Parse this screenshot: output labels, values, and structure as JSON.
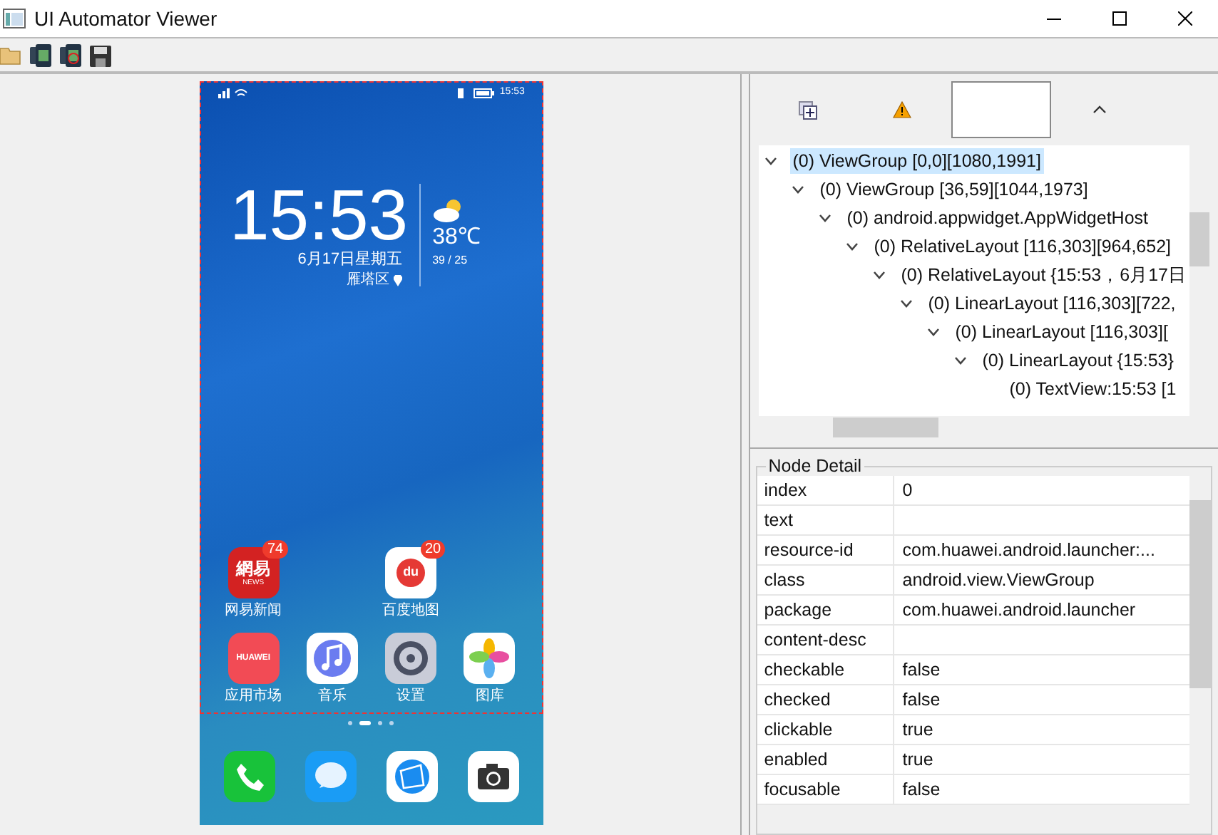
{
  "window": {
    "title": "UI Automator Viewer"
  },
  "phone": {
    "status_time": "15:53",
    "clock": "15:53",
    "date": "6月17日星期五",
    "location": "雁塔区",
    "temperature": "38℃",
    "temp_range": "39 / 25",
    "apps": [
      {
        "kind": "news",
        "label": "网易新闻",
        "badge": "74",
        "icon_text": "網易",
        "icon_subtext": "NEWS"
      },
      {
        "kind": "empty"
      },
      {
        "kind": "map",
        "label": "百度地图",
        "badge": "20",
        "icon_text": "du"
      },
      {
        "kind": "empty"
      },
      {
        "kind": "store",
        "label": "应用市场",
        "icon_text": "HUAWEI"
      },
      {
        "kind": "music",
        "label": "音乐"
      },
      {
        "kind": "settings",
        "label": "设置"
      },
      {
        "kind": "gallery",
        "label": "图库"
      }
    ],
    "pages": [
      {
        "selected": false
      },
      {
        "selected": true
      },
      {
        "selected": false
      },
      {
        "selected": false
      }
    ],
    "dock": [
      {
        "kind": "phone"
      },
      {
        "kind": "messages"
      },
      {
        "kind": "browser"
      },
      {
        "kind": "camera"
      }
    ]
  },
  "tree": [
    {
      "label": "(0) ViewGroup [0,0][1080,1991]",
      "selected": true,
      "expanded": true,
      "children": [
        {
          "label": "(0) ViewGroup [36,59][1044,1973]",
          "selected": false,
          "expanded": true,
          "children": [
            {
              "label": "(0) android.appwidget.AppWidgetHost",
              "selected": false,
              "expanded": true,
              "children": [
                {
                  "label": "(0) RelativeLayout [116,303][964,652]",
                  "selected": false,
                  "expanded": true,
                  "children": [
                    {
                      "label": "(0) RelativeLayout {15:53，6月17日",
                      "selected": false,
                      "expanded": true,
                      "children": [
                        {
                          "label": "(0) LinearLayout [116,303][722,",
                          "selected": false,
                          "expanded": true,
                          "children": [
                            {
                              "label": "(0) LinearLayout [116,303][",
                              "selected": false,
                              "expanded": true,
                              "children": [
                                {
                                  "label": "(0) LinearLayout {15:53}",
                                  "selected": false,
                                  "expanded": true,
                                  "children": [
                                    {
                                      "label": "(0) TextView:15:53 [1",
                                      "selected": false
                                    }
                                  ]
                                }
                              ]
                            }
                          ]
                        }
                      ]
                    }
                  ]
                }
              ]
            }
          ]
        }
      ]
    }
  ],
  "node_detail": {
    "title": "Node Detail",
    "rows": [
      {
        "key": "index",
        "value": "0"
      },
      {
        "key": "text"
      },
      {
        "key": "resource-id",
        "value": "com.huawei.android.launcher:..."
      },
      {
        "key": "class",
        "value": "android.view.ViewGroup"
      },
      {
        "key": "package",
        "value": "com.huawei.android.launcher"
      },
      {
        "key": "content-desc"
      },
      {
        "key": "checkable",
        "value": "false"
      },
      {
        "key": "checked",
        "value": "false"
      },
      {
        "key": "clickable",
        "value": "true"
      },
      {
        "key": "enabled",
        "value": "true"
      },
      {
        "key": "focusable",
        "value": "false"
      }
    ]
  }
}
